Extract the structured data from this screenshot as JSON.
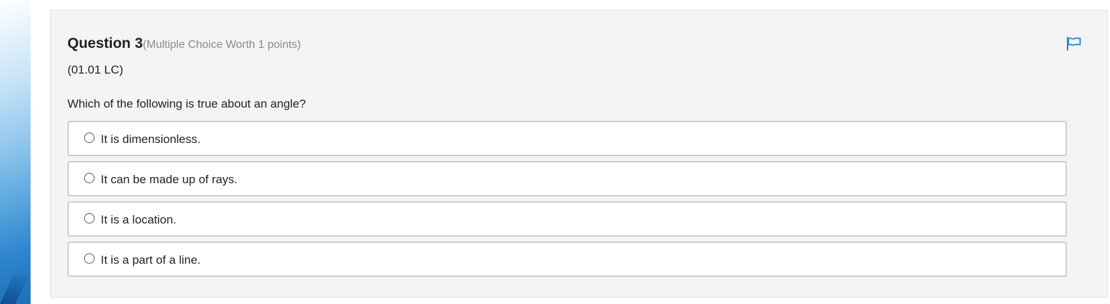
{
  "question": {
    "title": "Question 3",
    "meta": "(Multiple Choice Worth 1 points)",
    "code": "(01.01 LC)",
    "prompt": "Which of the following is true about an angle?",
    "flag_icon": "flag-icon",
    "options": [
      {
        "label": "It is dimensionless.",
        "selected": false
      },
      {
        "label": "It can be made up of rays.",
        "selected": false
      },
      {
        "label": "It is a location.",
        "selected": false
      },
      {
        "label": "It is a part of a line.",
        "selected": false
      }
    ]
  },
  "colors": {
    "accent": "#1a85c8",
    "card_background": "#f4f4f4",
    "option_border": "#cccccc"
  }
}
